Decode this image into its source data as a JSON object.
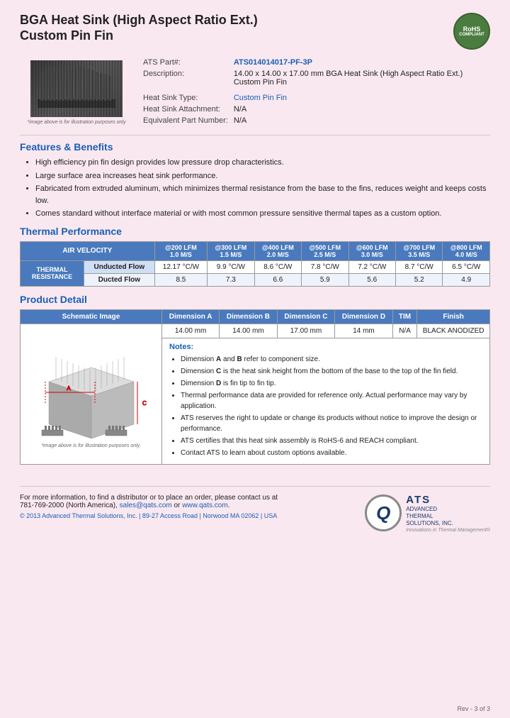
{
  "title": {
    "line1": "BGA Heat Sink (High Aspect Ratio Ext.)",
    "line2": "Custom Pin Fin"
  },
  "rohs": {
    "label": "RoHS",
    "sub": "COMPLIANT"
  },
  "partInfo": {
    "ats_part_label": "ATS Part#:",
    "ats_part_value": "ATS014014017-PF-3P",
    "description_label": "Description:",
    "description_value": "14.00 x 14.00 x 17.00 mm BGA Heat Sink (High Aspect Ratio Ext.) Custom Pin Fin",
    "heatsink_type_label": "Heat Sink Type:",
    "heatsink_type_value": "Custom Pin Fin",
    "attachment_label": "Heat Sink Attachment:",
    "attachment_value": "N/A",
    "equivalent_label": "Equivalent Part Number:",
    "equivalent_value": "N/A"
  },
  "image_caption": "*image above is for illustration purposes only",
  "features": {
    "title": "Features & Benefits",
    "items": [
      "High efficiency pin fin design provides low pressure drop characteristics.",
      "Large surface area increases heat sink performance.",
      "Fabricated from extruded aluminum, which minimizes thermal resistance from the base to the fins, reduces weight and keeps costs low.",
      "Comes standard without interface material or with most common pressure sensitive thermal tapes as a custom option."
    ]
  },
  "thermalPerformance": {
    "title": "Thermal Performance",
    "tableHeader": "AIR VELOCITY",
    "columns": [
      {
        "lfm": "@200 LFM",
        "ms": "1.0 M/S"
      },
      {
        "lfm": "@300 LFM",
        "ms": "1.5 M/S"
      },
      {
        "lfm": "@400 LFM",
        "ms": "2.0 M/S"
      },
      {
        "lfm": "@500 LFM",
        "ms": "2.5 M/S"
      },
      {
        "lfm": "@600 LFM",
        "ms": "3.0 M/S"
      },
      {
        "lfm": "@700 LFM",
        "ms": "3.5 M/S"
      },
      {
        "lfm": "@800 LFM",
        "ms": "4.0 M/S"
      }
    ],
    "rowLabel": "THERMAL RESISTANCE",
    "undirected_label": "Unducted Flow",
    "ducted_label": "Ducted Flow",
    "unducted_values": [
      "12.17 °C/W",
      "9.9 °C/W",
      "8.6 °C/W",
      "7.8 °C/W",
      "7.2 °C/W",
      "8.7 °C/W",
      "6.5 °C/W"
    ],
    "ducted_values": [
      "8.5",
      "7.3",
      "6.6",
      "5.9",
      "5.6",
      "5.2",
      "4.9"
    ]
  },
  "productDetail": {
    "title": "Product Detail",
    "schematicHeader": "Schematic Image",
    "dimAHeader": "Dimension A",
    "dimBHeader": "Dimension B",
    "dimCHeader": "Dimension C",
    "dimDHeader": "Dimension D",
    "timHeader": "TIM",
    "finishHeader": "Finish",
    "dimAValue": "14.00 mm",
    "dimBValue": "14.00 mm",
    "dimCValue": "17.00 mm",
    "dimDValue": "14 mm",
    "timValue": "N/A",
    "finishValue": "BLACK ANODIZED",
    "schematic_caption": "*image above is for illustration purposes only.",
    "notes_title": "Notes:",
    "notes": [
      {
        "text": "Dimension A and B refer to component size.",
        "bold_parts": [
          "A",
          "B"
        ]
      },
      {
        "text": "Dimension C is the heat sink height from the bottom of the base to the top of the fin field.",
        "bold_parts": [
          "C"
        ]
      },
      {
        "text": "Dimension D is fin tip to fin tip.",
        "bold_parts": [
          "D"
        ]
      },
      {
        "text": "Thermal performance data are provided for reference only. Actual performance may vary by application.",
        "bold_parts": []
      },
      {
        "text": "ATS reserves the right to update or change its products without notice to improve the design or performance.",
        "bold_parts": []
      },
      {
        "text": "ATS certifies that this heat sink assembly is RoHS-6 and REACH compliant.",
        "bold_parts": []
      },
      {
        "text": "Contact ATS to learn about custom options available.",
        "bold_parts": []
      }
    ]
  },
  "footer": {
    "contact_text": "For more information, to find a distributor or to place an order, please contact us at",
    "phone": "781-769-2000 (North America),",
    "email": "sales@qats.com",
    "or_text": "or",
    "website": "www.qats.com",
    "copyright": "© 2013 Advanced Thermal Solutions, Inc.",
    "address": "| 89-27 Access Road | Norwood MA  02062 | USA",
    "company_name": "ATS",
    "company_full1": "ADVANCED",
    "company_full2": "THERMAL",
    "company_full3": "SOLUTIONS, INC.",
    "tagline": "Innovations in Thermal Management®",
    "page_num": "Rev - 3 of 3"
  }
}
